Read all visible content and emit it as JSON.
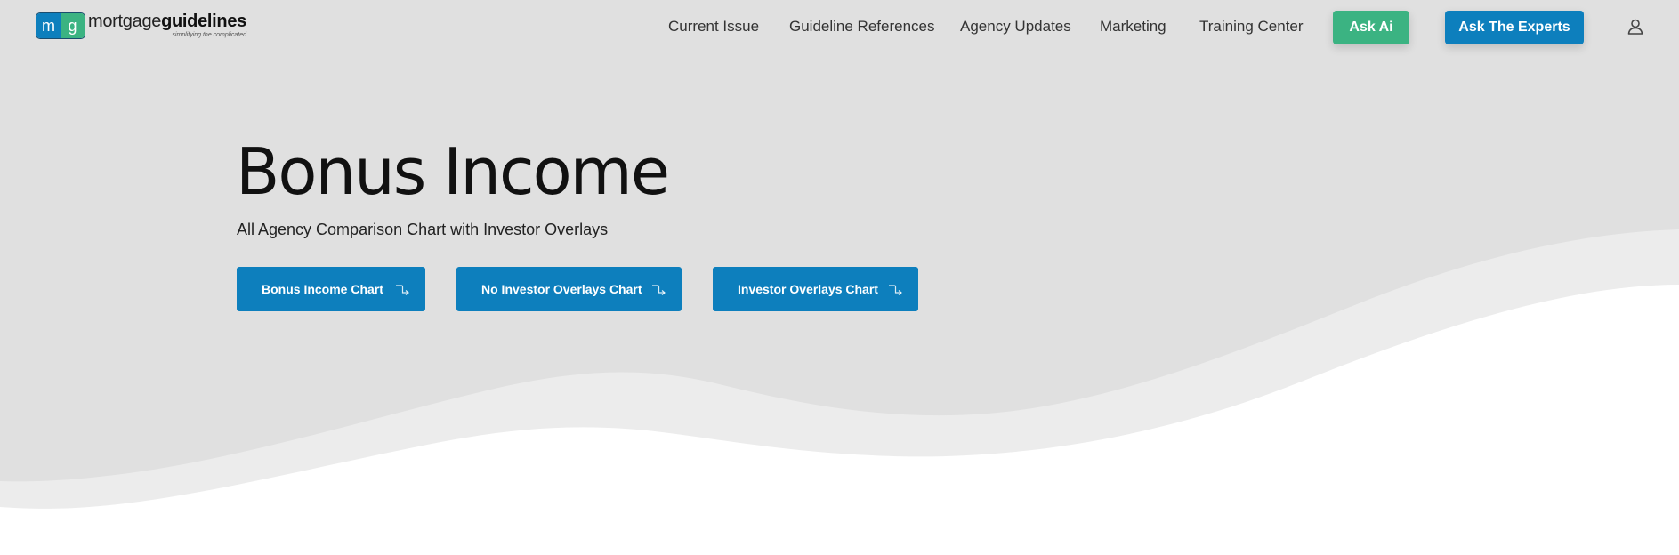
{
  "brand": {
    "badge_left": "m",
    "badge_right": "g",
    "name_light": "mortgage",
    "name_bold": "guidelines",
    "tagline": "...simplifying the complicated"
  },
  "nav": {
    "items": [
      {
        "label": "Current Issue"
      },
      {
        "label": "Guideline References"
      },
      {
        "label": "Agency Updates"
      },
      {
        "label": "Marketing"
      },
      {
        "label": "Training Center"
      }
    ],
    "ask_ai_label": "Ask Ai",
    "ask_experts_label": "Ask The Experts",
    "account_icon": "user-icon"
  },
  "hero": {
    "title": "Bonus Income",
    "subtitle": "All Agency Comparison Chart with Investor Overlays",
    "buttons": [
      {
        "label": "Bonus Income Chart",
        "icon": "arrow-down-right-icon"
      },
      {
        "label": "No Investor Overlays Chart",
        "icon": "arrow-down-right-icon"
      },
      {
        "label": "Investor Overlays Chart",
        "icon": "arrow-down-right-icon"
      }
    ]
  },
  "colors": {
    "primary_blue": "#0d7fbd",
    "accent_green": "#3bb382",
    "hero_background": "#e0e0e0",
    "wave_light": "#ececec"
  }
}
